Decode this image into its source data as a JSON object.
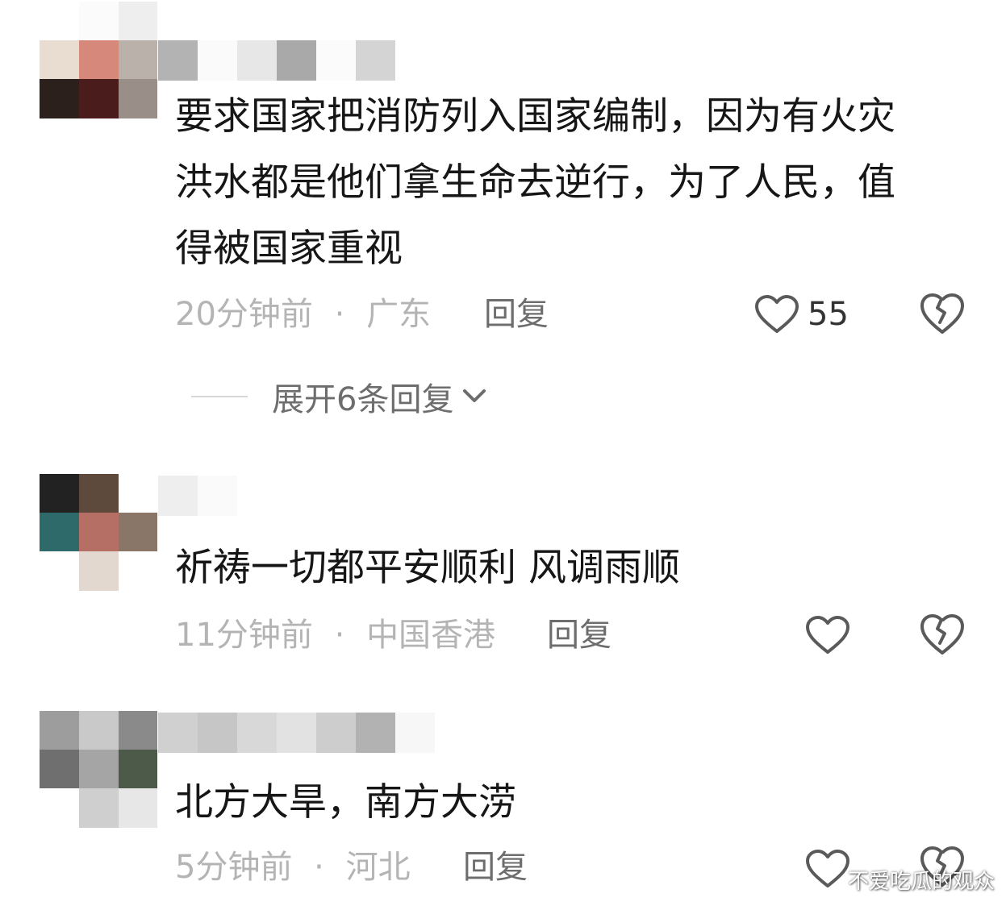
{
  "comments": [
    {
      "text": "要求国家把消防列入国家编制，因为有火灾\n洪水都是他们拿生命去逆行，为了人民，值\n得被国家重视",
      "time": "20分钟前",
      "separator": "·",
      "location": "广东",
      "reply_label": "回复",
      "likes": "55"
    },
    {
      "text": "祈祷一切都平安顺利 风调雨顺",
      "time": "11分钟前",
      "separator": "·",
      "location": "中国香港",
      "reply_label": "回复",
      "likes": ""
    },
    {
      "text": "北方大旱，南方大涝",
      "time": "5分钟前",
      "separator": "·",
      "location": "河北",
      "reply_label": "回复",
      "likes": ""
    }
  ],
  "expand_replies": {
    "label": "展开6条回复",
    "icon": "chevron-down-icon"
  },
  "icons": {
    "like": "heart-outline-icon",
    "dislike": "broken-heart-icon"
  },
  "colors": {
    "text": "#161616",
    "meta": "#b4b4b4",
    "action": "#6d6d6d",
    "icon": "#5a5a5a"
  },
  "watermark": "不爱吃瓜的观众"
}
